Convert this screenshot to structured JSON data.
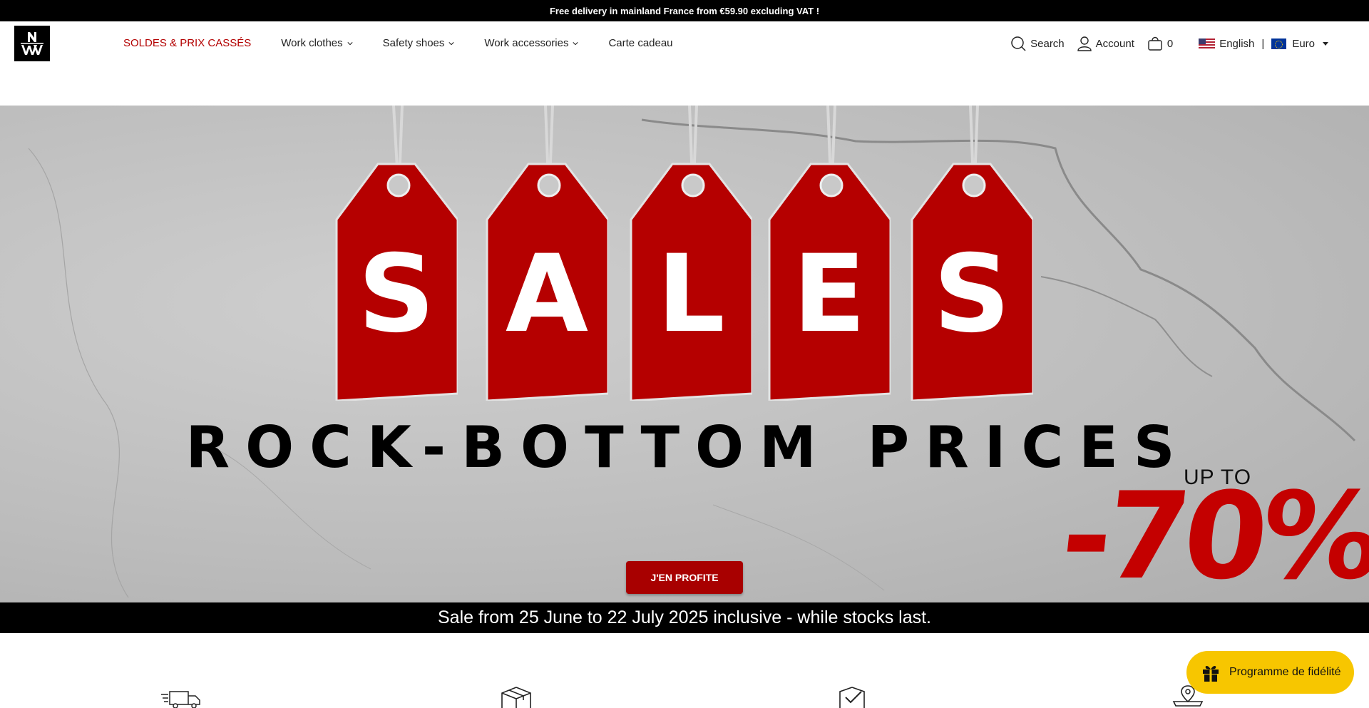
{
  "announcement": "Free delivery in mainland France from €59.90 excluding VAT !",
  "nav": {
    "sale": "SOLDES & PRIX CASSÉS",
    "work_clothes": "Work clothes",
    "safety_shoes": "Safety shoes",
    "work_accessories": "Work accessories",
    "gift_card": "Carte cadeau"
  },
  "utility": {
    "search": "Search",
    "account": "Account",
    "cart_count": "0",
    "language": "English",
    "separator": "|",
    "currency": "Euro"
  },
  "hero": {
    "tags": [
      "S",
      "A",
      "L",
      "E",
      "S"
    ],
    "headline": "ROCK-BOTTOM PRICES",
    "up_to": "UP TO",
    "discount": "-70%",
    "cta": "J'EN PROFITE"
  },
  "sale_bar": "Sale from 25 June to 22 July 2025 inclusive - while stocks last.",
  "loyalty": "Programme de fidélité",
  "colors": {
    "accent": "#b30000",
    "tag_red": "#b50000",
    "loyalty_yellow": "#f7c600"
  }
}
